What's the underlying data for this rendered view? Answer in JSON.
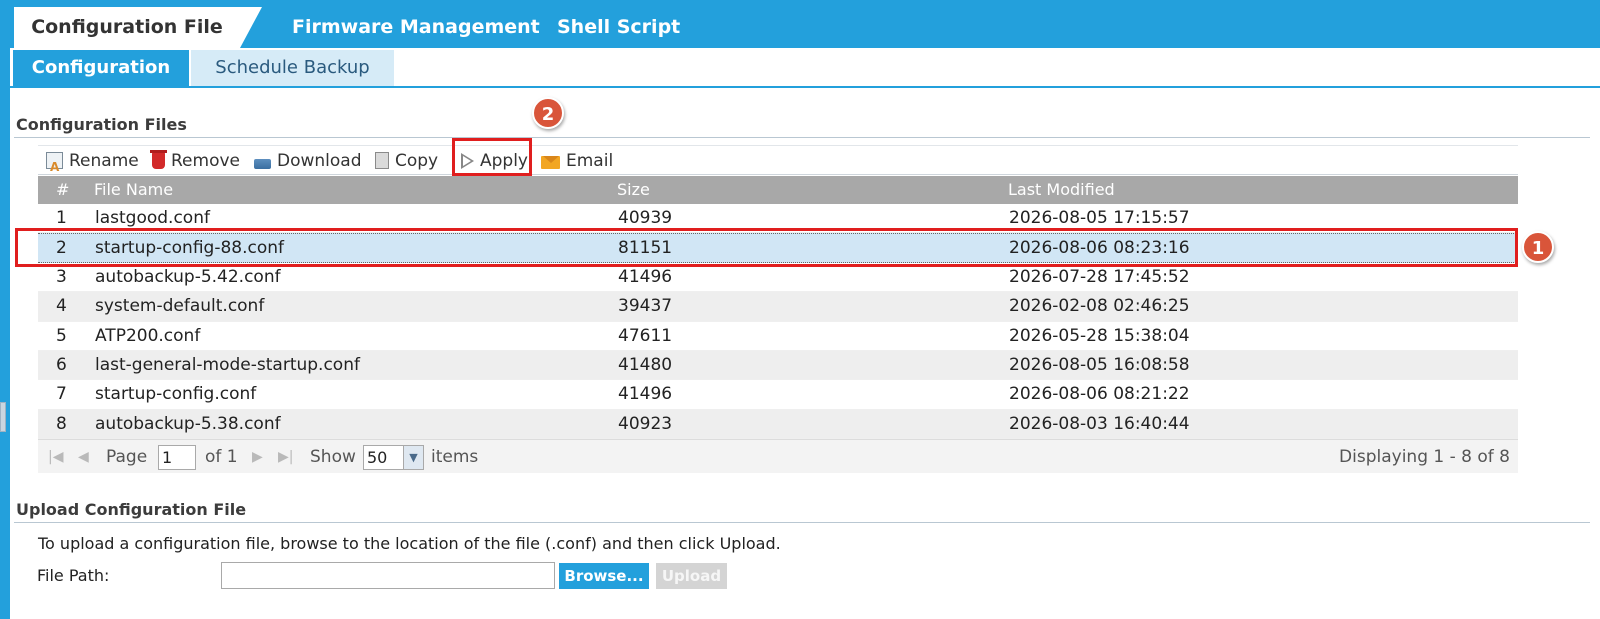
{
  "main_tabs": [
    {
      "label": "Configuration File",
      "active": true
    },
    {
      "label": "Firmware Management",
      "active": false
    },
    {
      "label": "Shell Script",
      "active": false
    }
  ],
  "sub_tabs": [
    {
      "label": "Configuration",
      "active": true
    },
    {
      "label": "Schedule Backup",
      "active": false
    }
  ],
  "config_files": {
    "title": "Configuration Files",
    "toolbar": {
      "rename": "Rename",
      "remove": "Remove",
      "download": "Download",
      "copy": "Copy",
      "apply": "Apply",
      "email": "Email"
    },
    "columns": [
      "#",
      "File Name",
      "Size",
      "Last Modified"
    ],
    "rows": [
      {
        "num": "1",
        "name": "lastgood.conf",
        "size": "40939",
        "modified": "2026-08-05 17:15:57"
      },
      {
        "num": "2",
        "name": "startup-config-88.conf",
        "size": "81151",
        "modified": "2026-08-06 08:23:16",
        "selected": true
      },
      {
        "num": "3",
        "name": "autobackup-5.42.conf",
        "size": "41496",
        "modified": "2026-07-28 17:45:52"
      },
      {
        "num": "4",
        "name": "system-default.conf",
        "size": "39437",
        "modified": "2026-02-08 02:46:25"
      },
      {
        "num": "5",
        "name": "ATP200.conf",
        "size": "47611",
        "modified": "2026-05-28 15:38:04"
      },
      {
        "num": "6",
        "name": "last-general-mode-startup.conf",
        "size": "41480",
        "modified": "2026-08-05 16:08:58"
      },
      {
        "num": "7",
        "name": "startup-config.conf",
        "size": "41496",
        "modified": "2026-08-06 08:21:22"
      },
      {
        "num": "8",
        "name": "autobackup-5.38.conf",
        "size": "40923",
        "modified": "2026-08-03 16:40:44"
      }
    ],
    "pager": {
      "page_label": "Page",
      "page_value": "1",
      "of_label": "of 1",
      "show_label": "Show",
      "show_value": "50",
      "items_label": "items",
      "displaying": "Displaying 1 - 8 of 8"
    }
  },
  "upload": {
    "title": "Upload Configuration File",
    "instructions": "To upload a configuration file, browse to the location of the file (.conf) and then click Upload.",
    "file_path_label": "File Path:",
    "file_path_value": "",
    "browse_label": "Browse...",
    "upload_label": "Upload"
  },
  "annotations": {
    "marker1": "1",
    "marker2": "2"
  },
  "colors": {
    "accent": "#23a0dc",
    "highlight": "#e01e1e",
    "marker": "#d9553a",
    "selected_row": "#d1e6f5"
  }
}
